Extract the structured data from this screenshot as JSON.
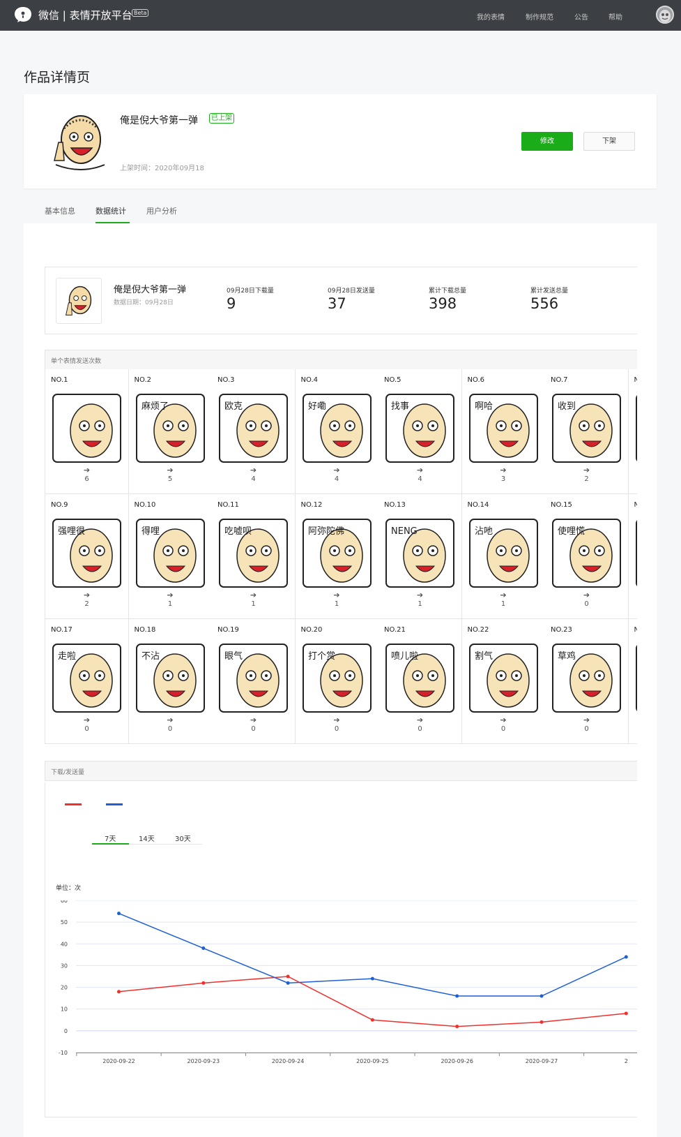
{
  "header": {
    "brand": "微信 | 表情开放平台",
    "beta": "Beta",
    "nav": [
      "我的表情",
      "制作规范",
      "公告",
      "帮助"
    ]
  },
  "page_title": "作品详情页",
  "work": {
    "title": "俺是倪大爷第一弹",
    "status": "已上架",
    "publish_time": "上架时间：2020年09月18",
    "edit_label": "修改",
    "offline_label": "下架"
  },
  "tabs": [
    "基本信息",
    "数据统计",
    "用户分析"
  ],
  "active_tab": "数据统计",
  "summary": {
    "name": "俺是倪大爷第一弹",
    "date": "数据日期：09月28日",
    "stats": [
      {
        "label": "09月28日下载量",
        "value": "9"
      },
      {
        "label": "09月28日发送量",
        "value": "37"
      },
      {
        "label": "累计下载总量",
        "value": "398"
      },
      {
        "label": "累计发送总量",
        "value": "556"
      }
    ]
  },
  "sticker_section_title": "单个表情发送次数",
  "stickers": [
    {
      "no": "NO.1",
      "count": "6",
      "caption": "",
      "col": "#f7e3b8"
    },
    {
      "no": "NO.2",
      "count": "5",
      "caption": "麻烦了",
      "col": "#f7e3b8"
    },
    {
      "no": "NO.3",
      "count": "4",
      "caption": "欧克",
      "col": "#f7e3b8"
    },
    {
      "no": "NO.4",
      "count": "4",
      "caption": "好嘞",
      "col": "#f7e3b8"
    },
    {
      "no": "NO.5",
      "count": "4",
      "caption": "找事",
      "col": "#f7e3b8"
    },
    {
      "no": "NO.6",
      "count": "3",
      "caption": "啊哈",
      "col": "#f7e3b8"
    },
    {
      "no": "NO.7",
      "count": "2",
      "caption": "收到",
      "col": "#f7e3b8"
    },
    {
      "no": "N",
      "count": "",
      "caption": "",
      "col": "#f7e3b8"
    },
    {
      "no": "NO.9",
      "count": "2",
      "caption": "强哩很",
      "col": "#f7e3b8"
    },
    {
      "no": "NO.10",
      "count": "1",
      "caption": "得哩",
      "col": "#f7e3b8"
    },
    {
      "no": "NO.11",
      "count": "1",
      "caption": "吃嘘呗",
      "col": "#f7e3b8"
    },
    {
      "no": "NO.12",
      "count": "1",
      "caption": "阿弥陀佛",
      "col": "#f7e3b8"
    },
    {
      "no": "NO.13",
      "count": "1",
      "caption": "NENG",
      "col": "#f7e3b8"
    },
    {
      "no": "NO.14",
      "count": "1",
      "caption": "沾吔",
      "col": "#f7e3b8"
    },
    {
      "no": "NO.15",
      "count": "0",
      "caption": "使哩慌",
      "col": "#f7e3b8"
    },
    {
      "no": "N",
      "count": "",
      "caption": "",
      "col": "#f7e3b8"
    },
    {
      "no": "NO.17",
      "count": "0",
      "caption": "走啦",
      "col": "#f7e3b8"
    },
    {
      "no": "NO.18",
      "count": "0",
      "caption": "不沾",
      "col": "#f7e3b8"
    },
    {
      "no": "NO.19",
      "count": "0",
      "caption": "眼气",
      "col": "#f7e3b8"
    },
    {
      "no": "NO.20",
      "count": "0",
      "caption": "打个赏",
      "col": "#f7e3b8"
    },
    {
      "no": "NO.21",
      "count": "0",
      "caption": "喷儿啦",
      "col": "#f7e3b8"
    },
    {
      "no": "NO.22",
      "count": "0",
      "caption": "割气",
      "col": "#f7e3b8"
    },
    {
      "no": "NO.23",
      "count": "0",
      "caption": "草鸡",
      "col": "#f7e3b8"
    },
    {
      "no": "N",
      "count": "",
      "caption": "",
      "col": "#f7e3b8"
    }
  ],
  "chart_section_title": "下载/发送量",
  "range_tabs": [
    "7天",
    "14天",
    "30天"
  ],
  "active_range": "7天",
  "chart_data": {
    "type": "line",
    "unit": "单位：次",
    "x": [
      "2020-09-22",
      "2020-09-23",
      "2020-09-24",
      "2020-09-25",
      "2020-09-26",
      "2020-09-27",
      "2"
    ],
    "ylim": [
      -10,
      60
    ],
    "yticks": [
      60,
      50,
      40,
      30,
      20,
      10,
      0,
      -10
    ],
    "grid": true,
    "legend": "top-left",
    "series": [
      {
        "color": "#f0302c",
        "values": [
          18,
          22,
          25,
          5,
          2,
          4,
          8
        ]
      },
      {
        "color": "#1e5fd6",
        "values": [
          54,
          38,
          22,
          24,
          16,
          16,
          34
        ]
      }
    ]
  },
  "colors": {
    "accent": "#1aad19",
    "topbar": "#3c3f43",
    "red_series": "#f0302c",
    "blue_series": "#1e5fd6"
  }
}
